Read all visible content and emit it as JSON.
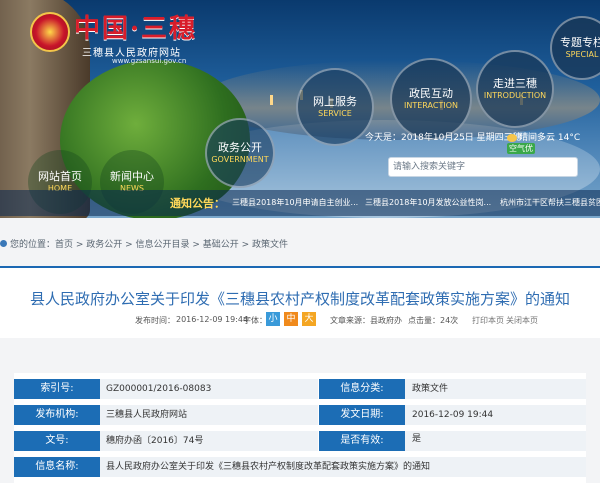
{
  "site": {
    "logo_title": "中国·三穗",
    "logo_subtitle": "三穗县人民政府网站",
    "logo_url": "www.gzsansui.gov.cn"
  },
  "nav": {
    "home": {
      "cn": "网站首页",
      "en": "HOME"
    },
    "news": {
      "cn": "新闻中心",
      "en": "NEWS"
    },
    "gov": {
      "cn": "政务公开",
      "en": "GOVERNMENT"
    },
    "service": {
      "cn": "网上服务",
      "en": "SERVICE"
    },
    "interaction": {
      "cn": "政民互动",
      "en": "INTERACTION"
    },
    "introduction": {
      "cn": "走进三穗",
      "en": "INTRODUCTION"
    },
    "special": {
      "cn": "专题专栏",
      "en": "SPECIAL"
    }
  },
  "infobar": {
    "date": "今天是：2018年10月25日 星期四三穗",
    "weather": "晴间多云 14°C",
    "aqi": "空气优"
  },
  "search": {
    "placeholder": "请输入搜索关键字"
  },
  "notice": {
    "label": "通知公告：",
    "items": [
      "三穗县2018年10月申请自主创业...",
      "三穗县2018年10月发放公益性岗...",
      "杭州市江干区帮扶三穗县贫困"
    ]
  },
  "breadcrumb": {
    "text": "您的位置：首页 > 政务公开 > 信息公开目录 > 基础公开 > 政策文件"
  },
  "article": {
    "title": "县人民政府办公室关于印发《三穗县农村产权制度改革配套政策实施方案》的通知",
    "meta_time_label": "发布时间：",
    "meta_time": "2016-12-09 19:44",
    "font_label": "字体：",
    "font_small": "小",
    "font_mid": "中",
    "font_big": "大",
    "source_label": "文章来源：",
    "source": "县政府办",
    "views_label": "点击量：",
    "views": "24次",
    "print": "打印本页",
    "close": "关闭本页"
  },
  "info": {
    "index_label": "索引号:",
    "index": "GZ000001/2016-08083",
    "category_label": "信息分类:",
    "category": "政策文件",
    "org_label": "发布机构:",
    "org": "三穗县人民政府网站",
    "date_label": "发文日期:",
    "date": "2016-12-09 19:44",
    "doc_label": "文号:",
    "doc": "穗府办函〔2016〕74号",
    "valid_label": "是否有效:",
    "valid": "是",
    "name_label": "信息名称:",
    "name": "县人民政府办公室关于印发《三穗县农村产权制度改革配套政策实施方案》的通知"
  },
  "colors": {
    "primary": "#1c6db5",
    "title": "#2f6db2",
    "accent": "#ffd85a",
    "logo_red": "#d81d2a"
  }
}
